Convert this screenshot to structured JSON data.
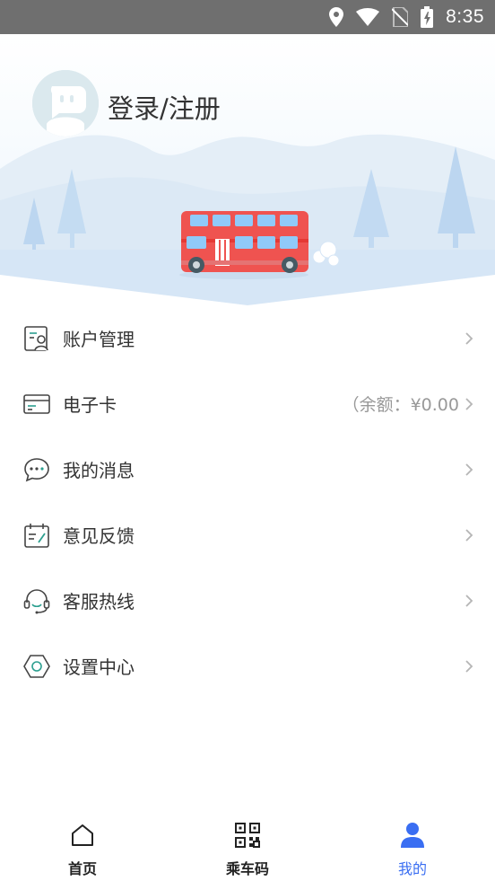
{
  "status_bar": {
    "time": "8:35",
    "icons": [
      "location-icon",
      "wifi-icon",
      "no-sim-icon",
      "battery-charging-icon"
    ]
  },
  "header": {
    "login_label": "登录/注册",
    "avatar_icon": "avatar-robot-icon"
  },
  "menu": {
    "items": [
      {
        "label": "账户管理",
        "icon": "account-manage-icon",
        "extra": ""
      },
      {
        "label": "电子卡",
        "icon": "card-icon",
        "extra": "（余额：¥0.00"
      },
      {
        "label": "我的消息",
        "icon": "message-icon",
        "extra": ""
      },
      {
        "label": "意见反馈",
        "icon": "feedback-icon",
        "extra": ""
      },
      {
        "label": "客服热线",
        "icon": "headset-icon",
        "extra": ""
      },
      {
        "label": "设置中心",
        "icon": "settings-icon",
        "extra": ""
      }
    ]
  },
  "bottom_nav": {
    "items": [
      {
        "label": "首页",
        "icon": "home-icon",
        "active": false
      },
      {
        "label": "乘车码",
        "icon": "qr-code-icon",
        "active": false
      },
      {
        "label": "我的",
        "icon": "profile-icon",
        "active": true
      }
    ]
  },
  "colors": {
    "accent": "#3a6ef2",
    "icon_teal": "#2c9f8f",
    "status_bar": "#6f6f6f",
    "bus_red": "#ef5350"
  }
}
